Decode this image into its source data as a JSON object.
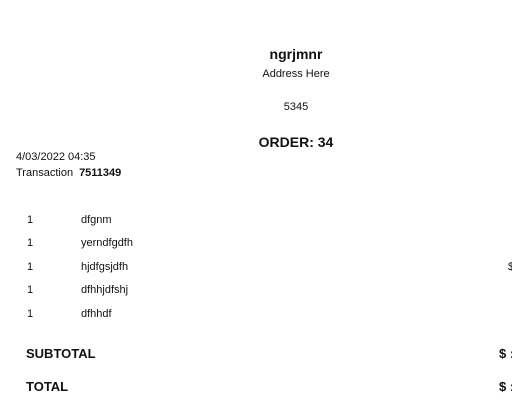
{
  "receipt": {
    "store_name": "ngrjmnr",
    "address": "Address Here",
    "store_number": "5345",
    "order_label": "ORDER: 34",
    "datetime": "4/03/2022 04:35",
    "transaction_label": "Transaction",
    "transaction_number": "7511349",
    "items": [
      {
        "qty": "1",
        "name": "dfgnm",
        "price_fragment": ""
      },
      {
        "qty": "1",
        "name": "yerndfgdfh",
        "price_fragment": ""
      },
      {
        "qty": "1",
        "name": "hjdfgsjdfh",
        "price_fragment": "$"
      },
      {
        "qty": "1",
        "name": "dfhhjdfshj",
        "price_fragment": ""
      },
      {
        "qty": "1",
        "name": "dfhhdf",
        "price_fragment": ""
      }
    ],
    "subtotal_label": "SUBTOTAL",
    "subtotal_value": "$ :",
    "total_label": "TOTAL",
    "total_value": "$ :"
  }
}
